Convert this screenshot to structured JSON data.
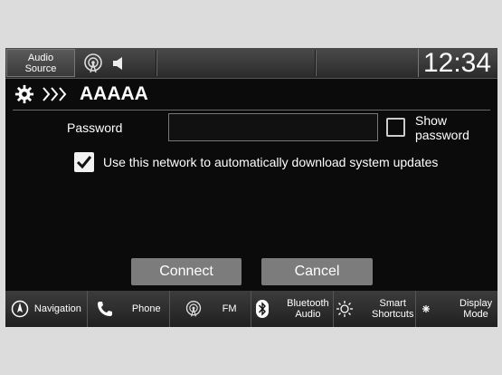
{
  "status_bar": {
    "audio_source_label": "Audio\nSource",
    "icons": [
      "radio-icon",
      "speaker-icon"
    ],
    "clock": "12:34"
  },
  "title_bar": {
    "icons": [
      "gear-icon",
      "chevrons-icon"
    ],
    "network_name": "AAAAA"
  },
  "form": {
    "password_label": "Password",
    "password_value": "",
    "show_password_label": "Show\npassword",
    "show_password_checked": false,
    "auto_update_label": "Use this network to automatically download system updates",
    "auto_update_checked": true
  },
  "actions": {
    "connect_label": "Connect",
    "cancel_label": "Cancel"
  },
  "nav": [
    {
      "label": "Navigation",
      "icon": "compass-icon"
    },
    {
      "label": "Phone",
      "icon": "phone-icon"
    },
    {
      "label": "FM",
      "icon": "fm-radio-icon"
    },
    {
      "label": "Bluetooth\nAudio",
      "icon": "bluetooth-icon"
    },
    {
      "label": "Smart\nShortcuts",
      "icon": "smart-shortcuts-icon"
    },
    {
      "label": "Display\nMode",
      "icon": "display-mode-icon"
    }
  ]
}
